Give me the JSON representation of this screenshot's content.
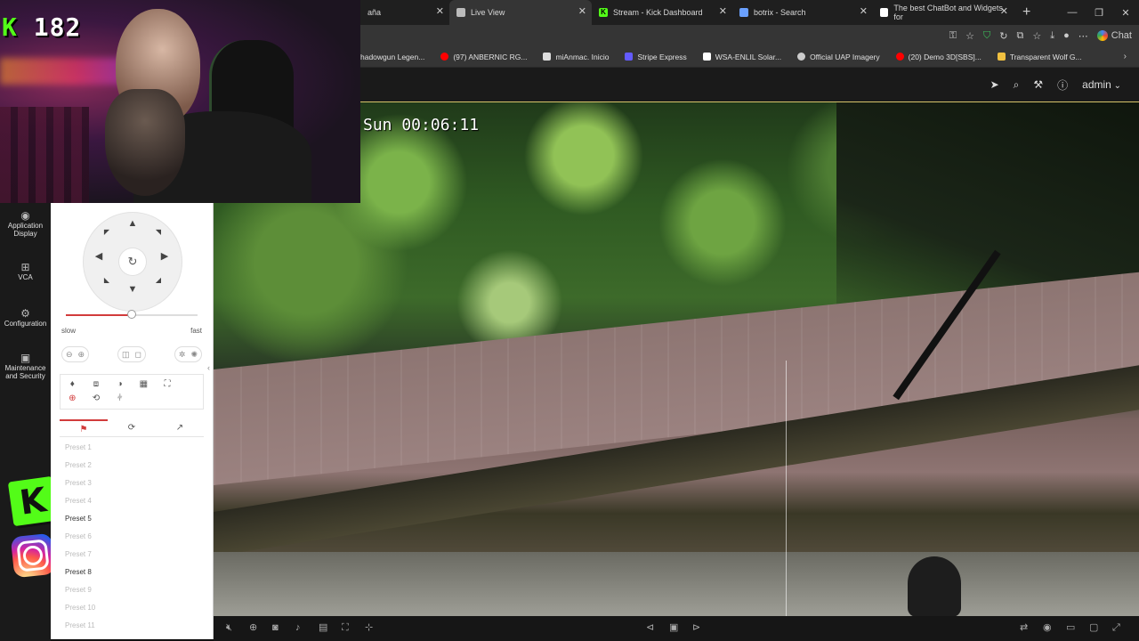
{
  "webcam": {
    "kick_prefix": "K",
    "kick_count": "182"
  },
  "browser": {
    "tabs": [
      {
        "label": "aña",
        "icon_color": "#1f1f1f",
        "icon": ""
      },
      {
        "label": "Live View",
        "icon_color": "#bbbbbb",
        "icon": "◎"
      },
      {
        "label": "Stream - Kick Dashboard",
        "icon_color": "#53fc18",
        "icon": "K"
      },
      {
        "label": "botrix - Search",
        "icon_color": "#6aa0ff",
        "icon": "◌"
      },
      {
        "label": "The best ChatBot and Widgets for",
        "icon_color": "#ffffff",
        "icon": "◆"
      }
    ],
    "chat_label": "Chat",
    "bookmarks": [
      {
        "label": "hadowgun Legen...",
        "color": "#444444"
      },
      {
        "label": "(97) ANBERNIC RG...",
        "color": "#ff0000"
      },
      {
        "label": "miAnmac. Inicio",
        "color": "#222222"
      },
      {
        "label": "Stripe Express",
        "color": "#635bff"
      },
      {
        "label": "WSA-ENLIL Solar...",
        "color": "#ffffff"
      },
      {
        "label": "Official UAP Imagery",
        "color": "#cccccc"
      },
      {
        "label": "(20) Demo 3D[SBS]...",
        "color": "#ff0000"
      },
      {
        "label": "Transparent Wolf G...",
        "color": "#f0c040"
      }
    ]
  },
  "app": {
    "user": "admin",
    "timestamp": "Sun 00:06:11",
    "nav": [
      {
        "label": "Application Display",
        "icon": "◉"
      },
      {
        "label": "VCA",
        "icon": "⊞"
      },
      {
        "label": "Configuration",
        "icon": "⚙"
      },
      {
        "label": "Maintenance and Security",
        "icon": "▣"
      }
    ],
    "ptz": {
      "speed_min": "slow",
      "speed_max": "fast",
      "speed_level": 0.5,
      "presets": [
        {
          "label": "Preset 1",
          "enabled": false
        },
        {
          "label": "Preset 2",
          "enabled": false
        },
        {
          "label": "Preset 3",
          "enabled": false
        },
        {
          "label": "Preset 4",
          "enabled": false
        },
        {
          "label": "Preset 5",
          "enabled": true
        },
        {
          "label": "Preset 6",
          "enabled": false
        },
        {
          "label": "Preset 7",
          "enabled": false
        },
        {
          "label": "Preset 8",
          "enabled": true
        },
        {
          "label": "Preset 9",
          "enabled": false
        },
        {
          "label": "Preset 10",
          "enabled": false
        },
        {
          "label": "Preset 11",
          "enabled": false
        }
      ]
    }
  },
  "colors": {
    "accent": "#d23c3c",
    "kick": "#53fc18"
  }
}
